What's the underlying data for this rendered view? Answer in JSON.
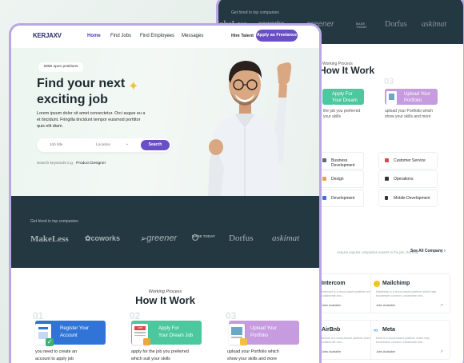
{
  "back": {
    "hired_label": "Get hired in top companies",
    "logos": [
      "MakeLess",
      "coworks",
      "greener",
      "BASE TODAY",
      "Dorfus",
      "askimat"
    ],
    "working_process": "Working Process",
    "how_title": "How It Work",
    "steps": [
      {
        "label_1": "Apply For",
        "label_2": "Your Dream Job",
        "desc_1": "the job you preferred",
        "desc_2": "your skills"
      },
      {
        "num": "03",
        "label_1": "Upload Your",
        "label_2": "Portfolio",
        "desc_1": "upload your Portfolio which",
        "desc_2": "show your skills and more"
      }
    ],
    "categories": [
      "Business Development",
      "Customer Service",
      "Design",
      "Operations",
      "Development",
      "Mobile Development"
    ],
    "companies_note": "Acquire popular companies experts in the job, Get it all",
    "see_all": "See All Company",
    "companies": [
      {
        "name": "Intercom",
        "desc": "Intercom is a cloud-based platform which help businesses connect, collaborate and...",
        "tag": "Jobs Available"
      },
      {
        "name": "Mailchimp",
        "desc": "Mailchimp is a cloud-based platform which help businesses connect, collaborate and...",
        "tag": "Jobs Available"
      },
      {
        "name": "AirBnb",
        "desc": "AirBnb is a cloud-based platform which help businesses connect, collaborate and...",
        "tag": "Jobs Available"
      },
      {
        "name": "Meta",
        "desc": "Meta is a cloud-based platform which help businesses connect, collaborate and...",
        "tag": "Jobs Available"
      }
    ]
  },
  "front": {
    "logo": "KERJAXV",
    "nav": [
      "Home",
      "Find Jobs",
      "Find Employees",
      "Messages"
    ],
    "hire_talent": "Hire Talent",
    "freelancer_btn": "Apply as Freelance",
    "open_positions": "2856 open positions",
    "headline_1": "Find your next",
    "headline_2": "exciting job",
    "subtext": "Lorem ipsum dolor sit amet consectetur. Orci augue eu a et tincidunt. Fringilla tincidunt tempor euismod porttitor quis elit diam.",
    "search": {
      "job_title": "Job title",
      "location": "Location",
      "button": "Search"
    },
    "keywords_label": "Search keywords e.g.",
    "keywords_value": "Product Designer",
    "hired_label": "Get hired in top companies",
    "logos": [
      "MakeLess",
      "coworks",
      "greener",
      "BASE TODAY",
      "Dorfus",
      "askimat"
    ],
    "working_process": "Working Process",
    "how_title": "How It Work",
    "steps": [
      {
        "num": "01",
        "label_1": "Register Your",
        "label_2": "Account",
        "desc_1": "you need to create an",
        "desc_2": "account to apply job"
      },
      {
        "num": "02",
        "label_1": "Apply For",
        "label_2": "Your Dream Job",
        "desc_1": "apply for the job you preferred",
        "desc_2": "which suit your skills"
      },
      {
        "num": "03",
        "label_1": "Upload Your",
        "label_2": "Portfolio",
        "desc_1": "upload your Portfolio which",
        "desc_2": "show your skills and more"
      }
    ]
  },
  "colors": {
    "accent": "#6a4fc4",
    "dark": "#243842",
    "border": "#b9a7e6",
    "blue": "#2f74d6",
    "green": "#4cc79e",
    "purple": "#c69be0",
    "sparkle": "#f1c238"
  }
}
